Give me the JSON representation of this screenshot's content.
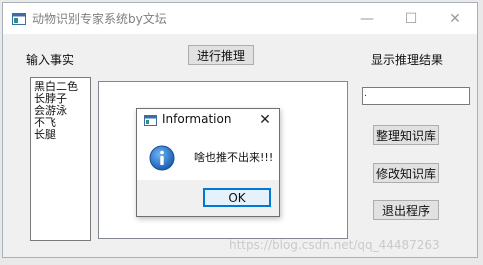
{
  "window": {
    "title": "动物识别专家系统by文坛",
    "controls": {
      "minimize": "—",
      "maximize": "☐",
      "close": "✕"
    }
  },
  "labels": {
    "input_facts": "输入事实",
    "show_result": "显示推理结果"
  },
  "buttons": {
    "infer": "进行推理",
    "organize_kb": "整理知识库",
    "modify_kb": "修改知识库",
    "exit": "退出程序"
  },
  "facts": [
    "黑白二色",
    "长脖子",
    "会游泳",
    "不飞",
    "长腿"
  ],
  "result": {
    "value": "."
  },
  "dialog": {
    "title": "Information",
    "close_glyph": "✕",
    "message": "啥也推不出来!!!",
    "ok_label": "OK",
    "icon": "info-icon"
  },
  "watermark": "https://blog.csdn.net/qq_44487263"
}
